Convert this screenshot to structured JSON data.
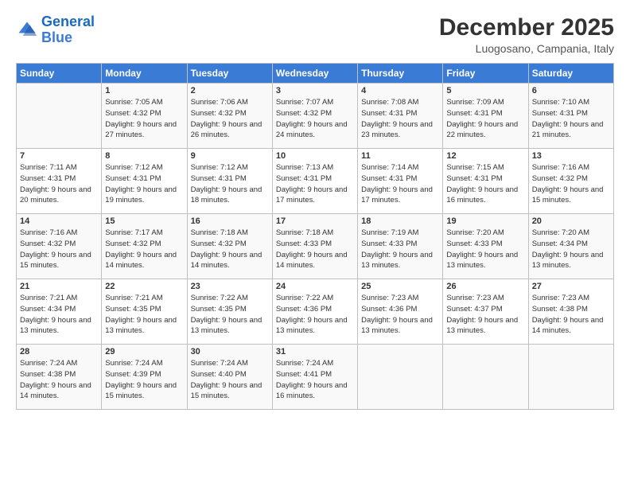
{
  "logo": {
    "line1": "General",
    "line2": "Blue"
  },
  "title": "December 2025",
  "location": "Luogosano, Campania, Italy",
  "days_of_week": [
    "Sunday",
    "Monday",
    "Tuesday",
    "Wednesday",
    "Thursday",
    "Friday",
    "Saturday"
  ],
  "weeks": [
    [
      {
        "num": "",
        "sunrise": "",
        "sunset": "",
        "daylight": ""
      },
      {
        "num": "1",
        "sunrise": "Sunrise: 7:05 AM",
        "sunset": "Sunset: 4:32 PM",
        "daylight": "Daylight: 9 hours and 27 minutes."
      },
      {
        "num": "2",
        "sunrise": "Sunrise: 7:06 AM",
        "sunset": "Sunset: 4:32 PM",
        "daylight": "Daylight: 9 hours and 26 minutes."
      },
      {
        "num": "3",
        "sunrise": "Sunrise: 7:07 AM",
        "sunset": "Sunset: 4:32 PM",
        "daylight": "Daylight: 9 hours and 24 minutes."
      },
      {
        "num": "4",
        "sunrise": "Sunrise: 7:08 AM",
        "sunset": "Sunset: 4:31 PM",
        "daylight": "Daylight: 9 hours and 23 minutes."
      },
      {
        "num": "5",
        "sunrise": "Sunrise: 7:09 AM",
        "sunset": "Sunset: 4:31 PM",
        "daylight": "Daylight: 9 hours and 22 minutes."
      },
      {
        "num": "6",
        "sunrise": "Sunrise: 7:10 AM",
        "sunset": "Sunset: 4:31 PM",
        "daylight": "Daylight: 9 hours and 21 minutes."
      }
    ],
    [
      {
        "num": "7",
        "sunrise": "Sunrise: 7:11 AM",
        "sunset": "Sunset: 4:31 PM",
        "daylight": "Daylight: 9 hours and 20 minutes."
      },
      {
        "num": "8",
        "sunrise": "Sunrise: 7:12 AM",
        "sunset": "Sunset: 4:31 PM",
        "daylight": "Daylight: 9 hours and 19 minutes."
      },
      {
        "num": "9",
        "sunrise": "Sunrise: 7:12 AM",
        "sunset": "Sunset: 4:31 PM",
        "daylight": "Daylight: 9 hours and 18 minutes."
      },
      {
        "num": "10",
        "sunrise": "Sunrise: 7:13 AM",
        "sunset": "Sunset: 4:31 PM",
        "daylight": "Daylight: 9 hours and 17 minutes."
      },
      {
        "num": "11",
        "sunrise": "Sunrise: 7:14 AM",
        "sunset": "Sunset: 4:31 PM",
        "daylight": "Daylight: 9 hours and 17 minutes."
      },
      {
        "num": "12",
        "sunrise": "Sunrise: 7:15 AM",
        "sunset": "Sunset: 4:31 PM",
        "daylight": "Daylight: 9 hours and 16 minutes."
      },
      {
        "num": "13",
        "sunrise": "Sunrise: 7:16 AM",
        "sunset": "Sunset: 4:32 PM",
        "daylight": "Daylight: 9 hours and 15 minutes."
      }
    ],
    [
      {
        "num": "14",
        "sunrise": "Sunrise: 7:16 AM",
        "sunset": "Sunset: 4:32 PM",
        "daylight": "Daylight: 9 hours and 15 minutes."
      },
      {
        "num": "15",
        "sunrise": "Sunrise: 7:17 AM",
        "sunset": "Sunset: 4:32 PM",
        "daylight": "Daylight: 9 hours and 14 minutes."
      },
      {
        "num": "16",
        "sunrise": "Sunrise: 7:18 AM",
        "sunset": "Sunset: 4:32 PM",
        "daylight": "Daylight: 9 hours and 14 minutes."
      },
      {
        "num": "17",
        "sunrise": "Sunrise: 7:18 AM",
        "sunset": "Sunset: 4:33 PM",
        "daylight": "Daylight: 9 hours and 14 minutes."
      },
      {
        "num": "18",
        "sunrise": "Sunrise: 7:19 AM",
        "sunset": "Sunset: 4:33 PM",
        "daylight": "Daylight: 9 hours and 13 minutes."
      },
      {
        "num": "19",
        "sunrise": "Sunrise: 7:20 AM",
        "sunset": "Sunset: 4:33 PM",
        "daylight": "Daylight: 9 hours and 13 minutes."
      },
      {
        "num": "20",
        "sunrise": "Sunrise: 7:20 AM",
        "sunset": "Sunset: 4:34 PM",
        "daylight": "Daylight: 9 hours and 13 minutes."
      }
    ],
    [
      {
        "num": "21",
        "sunrise": "Sunrise: 7:21 AM",
        "sunset": "Sunset: 4:34 PM",
        "daylight": "Daylight: 9 hours and 13 minutes."
      },
      {
        "num": "22",
        "sunrise": "Sunrise: 7:21 AM",
        "sunset": "Sunset: 4:35 PM",
        "daylight": "Daylight: 9 hours and 13 minutes."
      },
      {
        "num": "23",
        "sunrise": "Sunrise: 7:22 AM",
        "sunset": "Sunset: 4:35 PM",
        "daylight": "Daylight: 9 hours and 13 minutes."
      },
      {
        "num": "24",
        "sunrise": "Sunrise: 7:22 AM",
        "sunset": "Sunset: 4:36 PM",
        "daylight": "Daylight: 9 hours and 13 minutes."
      },
      {
        "num": "25",
        "sunrise": "Sunrise: 7:23 AM",
        "sunset": "Sunset: 4:36 PM",
        "daylight": "Daylight: 9 hours and 13 minutes."
      },
      {
        "num": "26",
        "sunrise": "Sunrise: 7:23 AM",
        "sunset": "Sunset: 4:37 PM",
        "daylight": "Daylight: 9 hours and 13 minutes."
      },
      {
        "num": "27",
        "sunrise": "Sunrise: 7:23 AM",
        "sunset": "Sunset: 4:38 PM",
        "daylight": "Daylight: 9 hours and 14 minutes."
      }
    ],
    [
      {
        "num": "28",
        "sunrise": "Sunrise: 7:24 AM",
        "sunset": "Sunset: 4:38 PM",
        "daylight": "Daylight: 9 hours and 14 minutes."
      },
      {
        "num": "29",
        "sunrise": "Sunrise: 7:24 AM",
        "sunset": "Sunset: 4:39 PM",
        "daylight": "Daylight: 9 hours and 15 minutes."
      },
      {
        "num": "30",
        "sunrise": "Sunrise: 7:24 AM",
        "sunset": "Sunset: 4:40 PM",
        "daylight": "Daylight: 9 hours and 15 minutes."
      },
      {
        "num": "31",
        "sunrise": "Sunrise: 7:24 AM",
        "sunset": "Sunset: 4:41 PM",
        "daylight": "Daylight: 9 hours and 16 minutes."
      },
      {
        "num": "",
        "sunrise": "",
        "sunset": "",
        "daylight": ""
      },
      {
        "num": "",
        "sunrise": "",
        "sunset": "",
        "daylight": ""
      },
      {
        "num": "",
        "sunrise": "",
        "sunset": "",
        "daylight": ""
      }
    ]
  ]
}
